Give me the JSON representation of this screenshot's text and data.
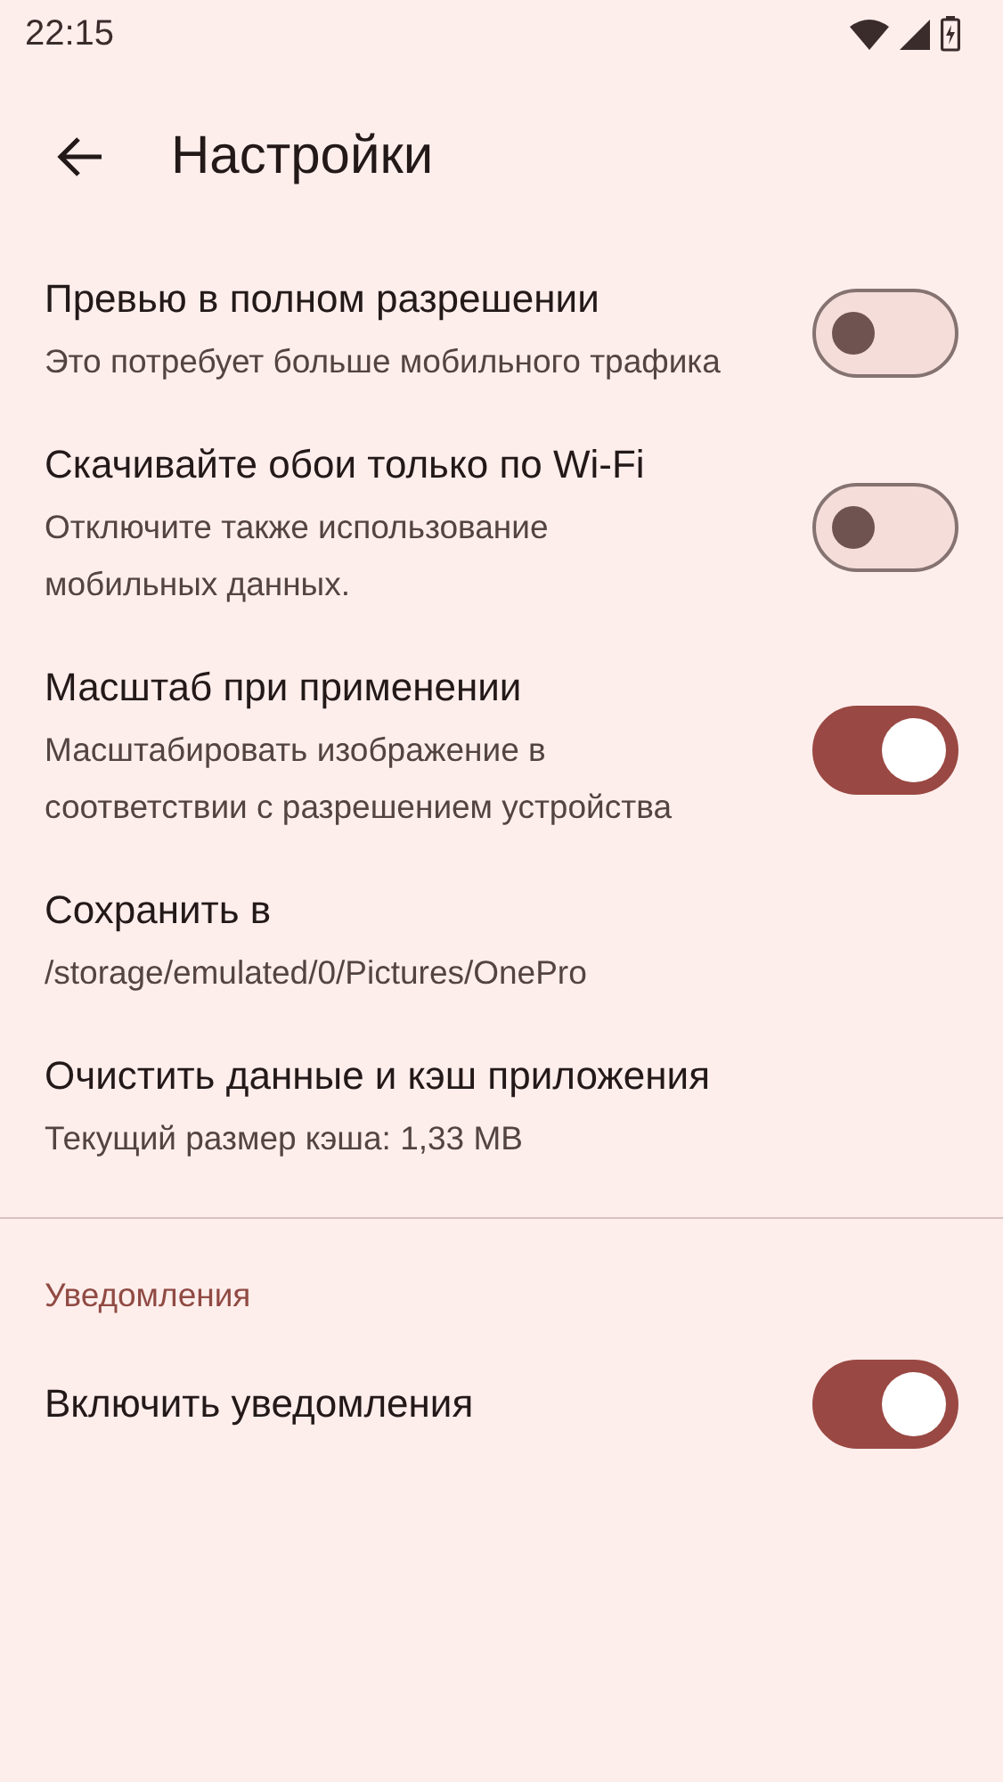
{
  "status_bar": {
    "time": "22:15"
  },
  "app_bar": {
    "title": "Настройки"
  },
  "settings": [
    {
      "kind": "toggle",
      "title": "Превью в полном разрешении",
      "summary": "Это потребует больше мобильного трафика",
      "on": false
    },
    {
      "kind": "toggle",
      "title": "Скачивайте обои только по Wi-Fi",
      "summary": "Отключите также использование мобильных данных.",
      "on": false
    },
    {
      "kind": "toggle",
      "title": "Масштаб при применении",
      "summary": "Масштабировать изображение в соответствии с разрешением устройства",
      "on": true
    },
    {
      "kind": "plain",
      "title": "Сохранить в",
      "summary": "/storage/emulated/0/Pictures/OnePro"
    },
    {
      "kind": "plain",
      "title": "Очистить данные и кэш приложения",
      "summary": "Текущий размер кэша: 1,33 MB"
    },
    {
      "kind": "divider"
    },
    {
      "kind": "header",
      "title": "Уведомления"
    },
    {
      "kind": "toggle",
      "title": "Включить уведомления",
      "on": true
    }
  ]
}
